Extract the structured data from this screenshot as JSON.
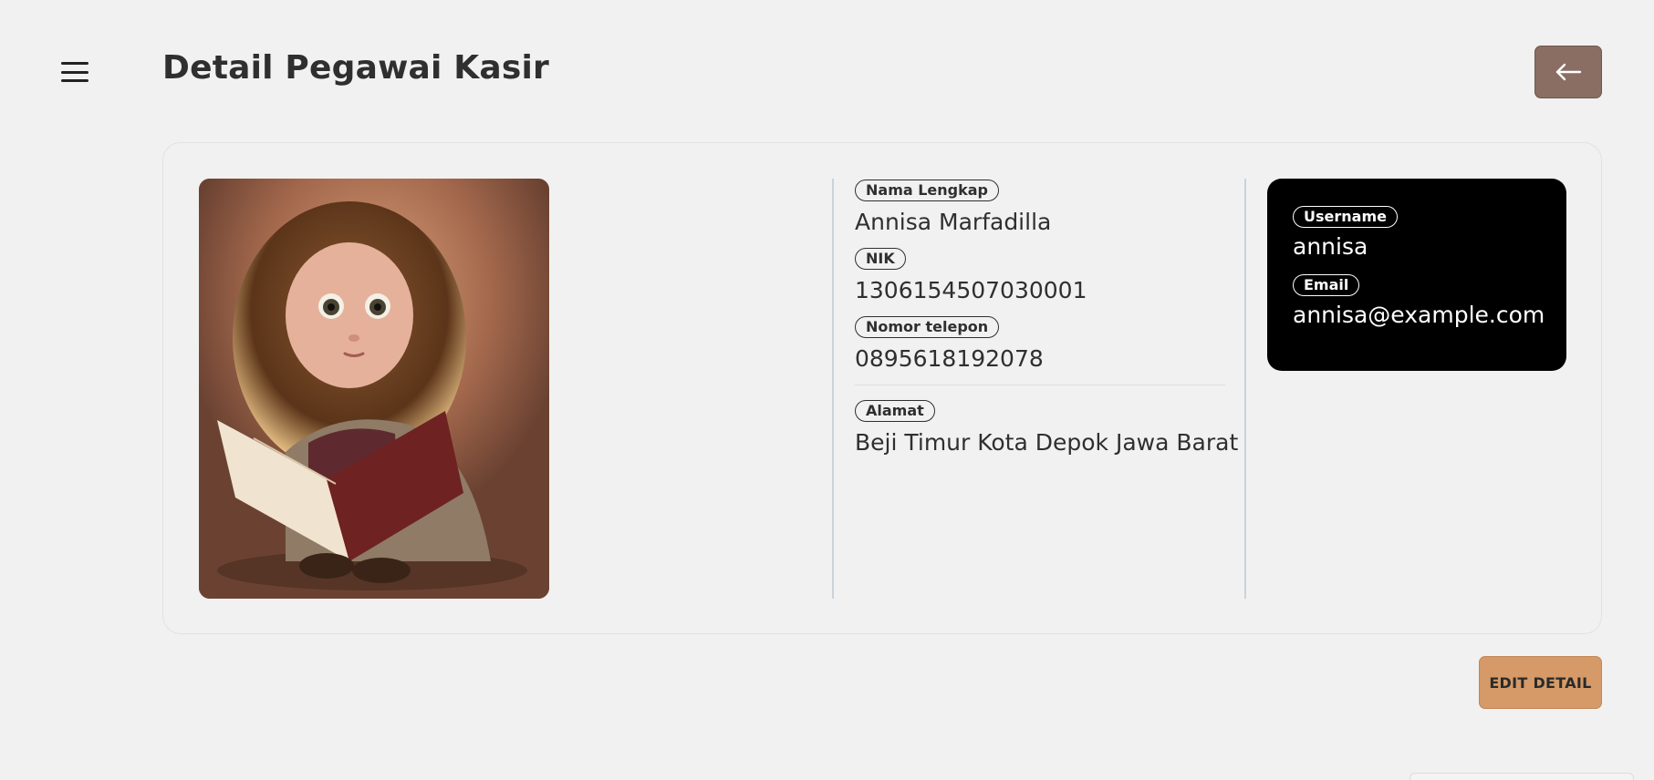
{
  "header": {
    "title": "Detail Pegawai Kasir",
    "menu_icon": "hamburger-menu-icon",
    "back_icon": "arrow-left-icon"
  },
  "employee": {
    "photo_icon": "employee-photo",
    "full_name_label": "Nama Lengkap",
    "full_name": "Annisa Marfadilla",
    "nik_label": "NIK",
    "nik": "1306154507030001",
    "phone_label": "Nomor telepon",
    "phone": "0895618192078",
    "address_label": "Alamat",
    "address": "Beji Timur Kota Depok Jawa Barat"
  },
  "account": {
    "username_label": "Username",
    "username": "annisa",
    "email_label": "Email",
    "email": "annisa@example.com"
  },
  "actions": {
    "edit_label": "EDIT DETAIL"
  },
  "colors": {
    "background": "#f1f1f1",
    "back_button": "#8a6e64",
    "edit_button": "#d59a68",
    "account_panel": "#000000"
  }
}
